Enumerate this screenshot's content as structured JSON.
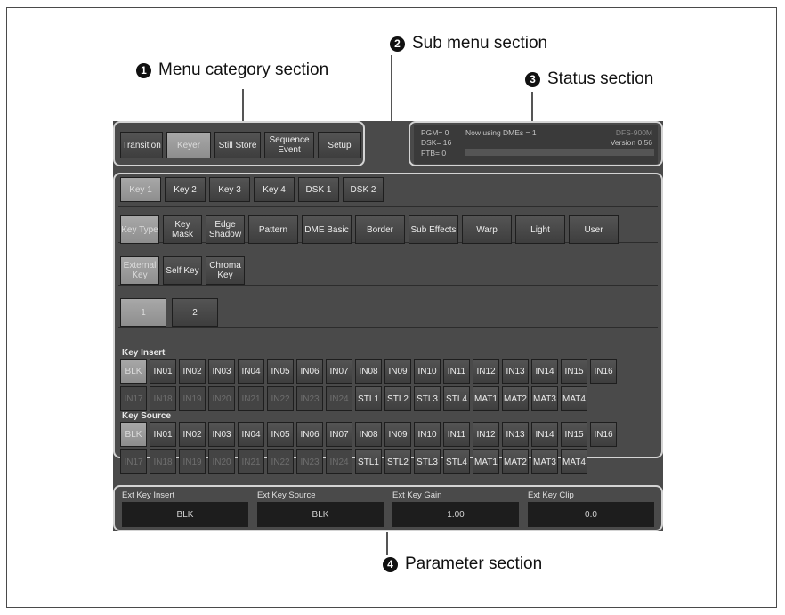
{
  "callouts": [
    {
      "num": "1",
      "label": "Menu category section"
    },
    {
      "num": "2",
      "label": "Sub menu section"
    },
    {
      "num": "3",
      "label": "Status section"
    },
    {
      "num": "4",
      "label": "Parameter section"
    }
  ],
  "menu_categories": [
    "Transition",
    "Keyer",
    "Still Store",
    "Sequence Event",
    "Setup"
  ],
  "status": {
    "pgm": "PGM= 0",
    "now_using": "Now using DMEs = 1",
    "model": "DFS-900M",
    "dsk": "DSK= 16",
    "version": "Version 0.56",
    "ftb": "FTB= 0"
  },
  "key_tabs": [
    "Key 1",
    "Key 2",
    "Key 3",
    "Key 4",
    "DSK 1",
    "DSK 2"
  ],
  "sub_tabs": [
    "Key Type",
    "Key Mask",
    "Edge Shadow",
    "Pattern",
    "DME Basic",
    "Border",
    "Sub Effects",
    "Warp",
    "Light",
    "User"
  ],
  "type_tabs": [
    "External Key",
    "Self Key",
    "Chroma Key"
  ],
  "page_tabs": [
    "1",
    "2"
  ],
  "key_insert_label": "Key Insert",
  "key_source_label": "Key Source",
  "row1": [
    "BLK",
    "IN01",
    "IN02",
    "IN03",
    "IN04",
    "IN05",
    "IN06",
    "IN07",
    "IN08",
    "IN09",
    "IN10",
    "IN11",
    "IN12",
    "IN13",
    "IN14",
    "IN15",
    "IN16"
  ],
  "row2": [
    "IN17",
    "IN18",
    "IN19",
    "IN20",
    "IN21",
    "IN22",
    "IN23",
    "IN24",
    "STL1",
    "STL2",
    "STL3",
    "STL4",
    "MAT1",
    "MAT2",
    "MAT3",
    "MAT4"
  ],
  "parameters": [
    {
      "label": "Ext Key Insert",
      "value": "BLK"
    },
    {
      "label": "Ext Key Source",
      "value": "BLK"
    },
    {
      "label": "Ext Key Gain",
      "value": "1.00"
    },
    {
      "label": "Ext Key Clip",
      "value": "0.0"
    }
  ]
}
